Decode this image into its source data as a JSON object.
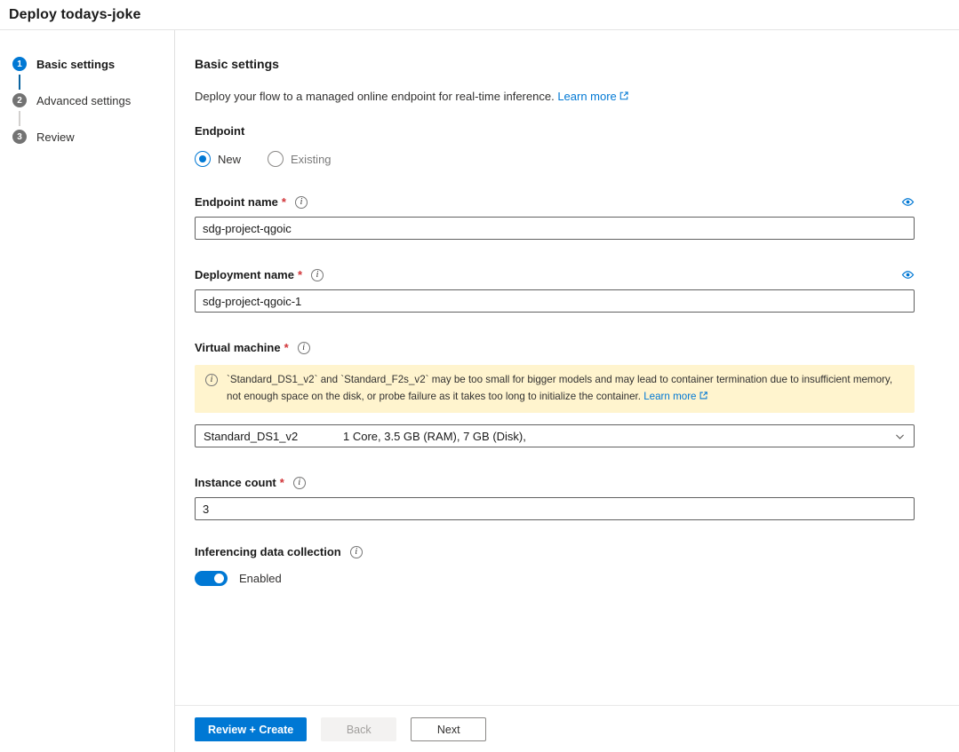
{
  "header": {
    "title": "Deploy todays-joke"
  },
  "wizard": {
    "steps": [
      {
        "num": "1",
        "label": "Basic settings"
      },
      {
        "num": "2",
        "label": "Advanced settings"
      },
      {
        "num": "3",
        "label": "Review"
      }
    ]
  },
  "main": {
    "heading": "Basic settings",
    "description": "Deploy your flow to a managed online endpoint for real-time inference.",
    "learn_more_label": "Learn more",
    "endpoint_label": "Endpoint",
    "radio_new": "New",
    "radio_existing": "Existing",
    "endpoint_name": {
      "label": "Endpoint name",
      "required_mark": "*",
      "value": "sdg-project-qgoic"
    },
    "deployment_name": {
      "label": "Deployment name",
      "required_mark": "*",
      "value": "sdg-project-qgoic-1"
    },
    "virtual_machine": {
      "label": "Virtual machine",
      "required_mark": "*",
      "warning_text": "`Standard_DS1_v2` and `Standard_F2s_v2` may be too small for bigger models and may lead to container termination due to insufficient memory, not enough space on the disk, or probe failure as it takes too long to initialize the container.",
      "warning_learn_more": "Learn more",
      "selected_sku": "Standard_DS1_v2",
      "selected_specs": "1 Core, 3.5 GB (RAM), 7 GB (Disk),"
    },
    "instance_count": {
      "label": "Instance count",
      "required_mark": "*",
      "value": "3"
    },
    "data_collection": {
      "label": "Inferencing data collection",
      "state_label": "Enabled"
    }
  },
  "footer": {
    "review_create_label": "Review + Create",
    "back_label": "Back",
    "next_label": "Next"
  },
  "colors": {
    "accent": "#0078d4",
    "warning_bg": "#fff4ce",
    "required": "#d13438"
  }
}
